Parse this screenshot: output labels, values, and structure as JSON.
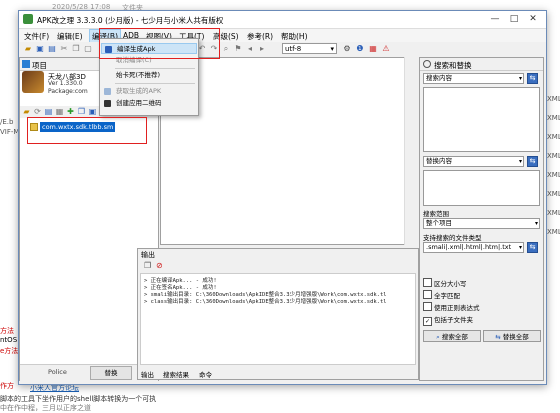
{
  "background": {
    "top_texts": [
      "2020/5/28 17:08",
      "文件夹"
    ],
    "left_texts": [
      "/E.b",
      "VIF-M"
    ],
    "right_texts": [
      "XML",
      "XML",
      "XML",
      "XML",
      "XML",
      "XML",
      "XML",
      "XML"
    ],
    "bottom_left_labels": [
      "方法",
      "ntOS",
      "e方法",
      "作方"
    ],
    "bottom_link": "小米人官方论坛",
    "bottom_text": "脚本的工具下坐作用户的shell脚本转换为一个可执",
    "bottom_text2": "中在作中程，三月以正序之道"
  },
  "window": {
    "title": "APK改之理 3.3.3.0 (少月版) - 七少月与小米人共有版权",
    "controls": [
      "—",
      "□",
      "✕"
    ]
  },
  "menubar": {
    "items": [
      "文件(F)",
      "编辑(E)",
      "编译(B)",
      "ADB",
      "视图(V)",
      "工具(T)",
      "高级(S)",
      "参考(R)",
      "帮助(H)"
    ],
    "active_index": 2
  },
  "toolbar": {
    "encoding": "utf-8"
  },
  "dropdown": {
    "items": [
      {
        "label": "编译生成Apk",
        "highlighted": true,
        "disabled": false
      },
      {
        "label": "取消编译(C)",
        "highlighted": false,
        "disabled": true
      },
      {
        "label": "始卡死(不推荐)",
        "highlighted": false,
        "disabled": false
      },
      {
        "label": "获取生成的APK",
        "highlighted": false,
        "disabled": true
      },
      {
        "label": "创建应用二维码",
        "highlighted": false,
        "disabled": false
      }
    ]
  },
  "left_panel": {
    "title": "项目",
    "banner_line1": "天龙八部3D",
    "banner_line2": "Ver 1.330.0",
    "banner_line3": "Package:com",
    "tree_item": "com.wxtx.sdk.tlbb.sm",
    "bottom_label": "Police",
    "bottom_button": "替换"
  },
  "output": {
    "title": "输出",
    "lines": [
      "> 正在编译Apk... - 成功!",
      "> 正在签名Apk... - 成功!",
      "> smali输出目录: C:\\360Downloads\\ApkIDE整合3.3少月增强版\\Work\\com.wxtx.sdk.tl",
      "> class输出目录: C:\\360Downloads\\ApkIDE整合3.3少月增强版\\Work\\com.wxtx.sdk.tl"
    ],
    "tabs": [
      "输出",
      "搜索结果",
      "命令"
    ]
  },
  "search_panel": {
    "title": "搜索和替换",
    "search_placeholder": "搜索内容",
    "replace_placeholder": "替换内容",
    "scope_label": "搜索范围",
    "scope_value": "整个项目",
    "filetypes_label": "支持搜索的文件类型",
    "filetypes_value": ".smali|.xml|.html|.htm|.txt",
    "options": [
      {
        "label": "区分大小写",
        "checked": false
      },
      {
        "label": "全字匹配",
        "checked": false
      },
      {
        "label": "使用正则表达式",
        "checked": false
      },
      {
        "label": "包括子文件夹",
        "checked": true
      }
    ],
    "search_all_button": "搜索全部",
    "replace_all_button": "替换全部"
  },
  "colors": {
    "highlight": "#cce4f7",
    "selected_item": "#0a64c8",
    "annotation_red": "#e02020"
  }
}
